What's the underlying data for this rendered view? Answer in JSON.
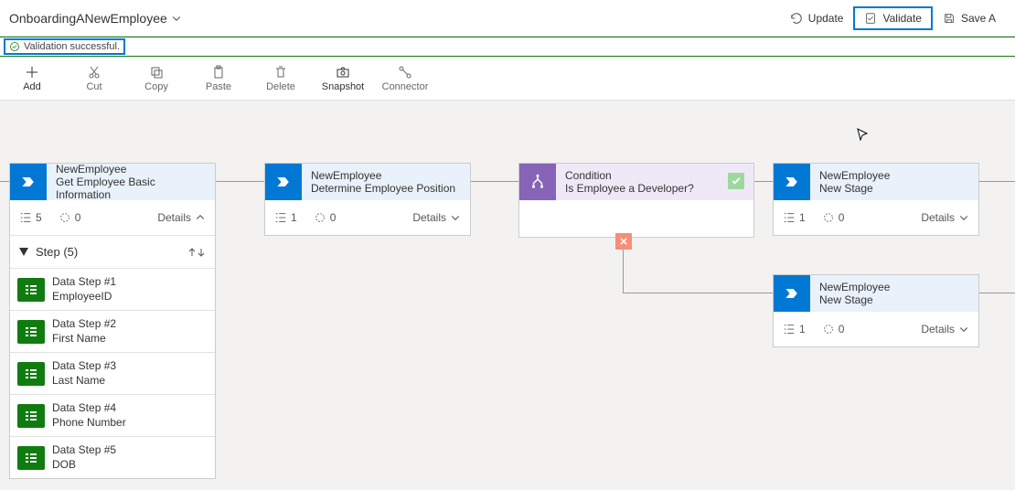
{
  "title": "OnboardingANewEmployee",
  "actions": {
    "update": "Update",
    "validate": "Validate",
    "save": "Save A"
  },
  "validation_message": "Validation successful.",
  "toolbar": {
    "add": "Add",
    "cut": "Cut",
    "copy": "Copy",
    "paste": "Paste",
    "delete": "Delete",
    "snapshot": "Snapshot",
    "connector": "Connector"
  },
  "stages": [
    {
      "entity": "NewEmployee",
      "name": "Get Employee Basic Information",
      "step_count": "5",
      "flow_count": "0",
      "details_label": "Details",
      "expanded": true,
      "steps_header": "Step (5)",
      "steps": [
        {
          "title": "Data Step #1",
          "field": "EmployeeID"
        },
        {
          "title": "Data Step #2",
          "field": "First Name"
        },
        {
          "title": "Data Step #3",
          "field": "Last Name"
        },
        {
          "title": "Data Step #4",
          "field": "Phone Number"
        },
        {
          "title": "Data Step #5",
          "field": "DOB"
        }
      ]
    },
    {
      "entity": "NewEmployee",
      "name": "Determine Employee Position",
      "step_count": "1",
      "flow_count": "0",
      "details_label": "Details"
    },
    {
      "entity": "NewEmployee",
      "name": "New Stage",
      "step_count": "1",
      "flow_count": "0",
      "details_label": "Details"
    },
    {
      "entity": "NewEmployee",
      "name": "New Stage",
      "step_count": "1",
      "flow_count": "0",
      "details_label": "Details"
    }
  ],
  "condition": {
    "label": "Condition",
    "text": "Is Employee a Developer?"
  }
}
